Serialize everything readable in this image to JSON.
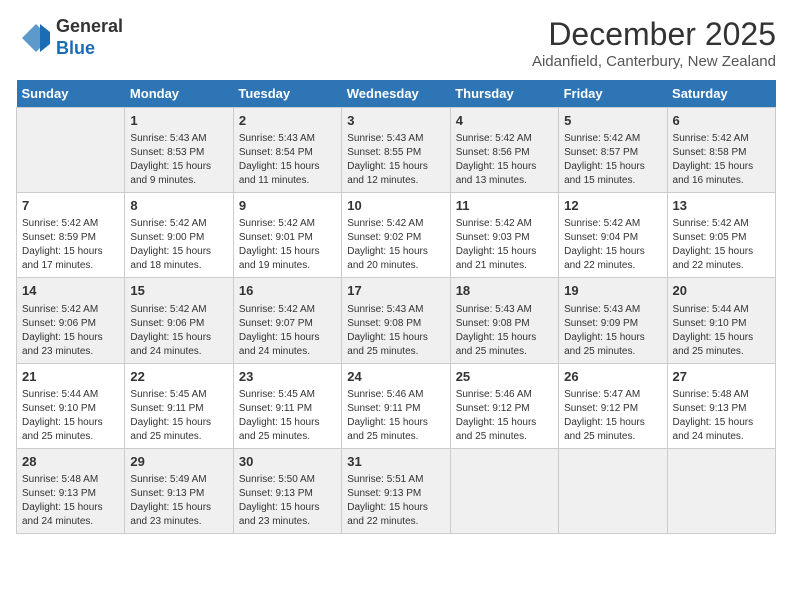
{
  "header": {
    "logo_line1": "General",
    "logo_line2": "Blue",
    "title": "December 2025",
    "location": "Aidanfield, Canterbury, New Zealand"
  },
  "calendar": {
    "days_of_week": [
      "Sunday",
      "Monday",
      "Tuesday",
      "Wednesday",
      "Thursday",
      "Friday",
      "Saturday"
    ],
    "weeks": [
      [
        {
          "day": "",
          "info": ""
        },
        {
          "day": "1",
          "info": "Sunrise: 5:43 AM\nSunset: 8:53 PM\nDaylight: 15 hours\nand 9 minutes."
        },
        {
          "day": "2",
          "info": "Sunrise: 5:43 AM\nSunset: 8:54 PM\nDaylight: 15 hours\nand 11 minutes."
        },
        {
          "day": "3",
          "info": "Sunrise: 5:43 AM\nSunset: 8:55 PM\nDaylight: 15 hours\nand 12 minutes."
        },
        {
          "day": "4",
          "info": "Sunrise: 5:42 AM\nSunset: 8:56 PM\nDaylight: 15 hours\nand 13 minutes."
        },
        {
          "day": "5",
          "info": "Sunrise: 5:42 AM\nSunset: 8:57 PM\nDaylight: 15 hours\nand 15 minutes."
        },
        {
          "day": "6",
          "info": "Sunrise: 5:42 AM\nSunset: 8:58 PM\nDaylight: 15 hours\nand 16 minutes."
        }
      ],
      [
        {
          "day": "7",
          "info": "Sunrise: 5:42 AM\nSunset: 8:59 PM\nDaylight: 15 hours\nand 17 minutes."
        },
        {
          "day": "8",
          "info": "Sunrise: 5:42 AM\nSunset: 9:00 PM\nDaylight: 15 hours\nand 18 minutes."
        },
        {
          "day": "9",
          "info": "Sunrise: 5:42 AM\nSunset: 9:01 PM\nDaylight: 15 hours\nand 19 minutes."
        },
        {
          "day": "10",
          "info": "Sunrise: 5:42 AM\nSunset: 9:02 PM\nDaylight: 15 hours\nand 20 minutes."
        },
        {
          "day": "11",
          "info": "Sunrise: 5:42 AM\nSunset: 9:03 PM\nDaylight: 15 hours\nand 21 minutes."
        },
        {
          "day": "12",
          "info": "Sunrise: 5:42 AM\nSunset: 9:04 PM\nDaylight: 15 hours\nand 22 minutes."
        },
        {
          "day": "13",
          "info": "Sunrise: 5:42 AM\nSunset: 9:05 PM\nDaylight: 15 hours\nand 22 minutes."
        }
      ],
      [
        {
          "day": "14",
          "info": "Sunrise: 5:42 AM\nSunset: 9:06 PM\nDaylight: 15 hours\nand 23 minutes."
        },
        {
          "day": "15",
          "info": "Sunrise: 5:42 AM\nSunset: 9:06 PM\nDaylight: 15 hours\nand 24 minutes."
        },
        {
          "day": "16",
          "info": "Sunrise: 5:42 AM\nSunset: 9:07 PM\nDaylight: 15 hours\nand 24 minutes."
        },
        {
          "day": "17",
          "info": "Sunrise: 5:43 AM\nSunset: 9:08 PM\nDaylight: 15 hours\nand 25 minutes."
        },
        {
          "day": "18",
          "info": "Sunrise: 5:43 AM\nSunset: 9:08 PM\nDaylight: 15 hours\nand 25 minutes."
        },
        {
          "day": "19",
          "info": "Sunrise: 5:43 AM\nSunset: 9:09 PM\nDaylight: 15 hours\nand 25 minutes."
        },
        {
          "day": "20",
          "info": "Sunrise: 5:44 AM\nSunset: 9:10 PM\nDaylight: 15 hours\nand 25 minutes."
        }
      ],
      [
        {
          "day": "21",
          "info": "Sunrise: 5:44 AM\nSunset: 9:10 PM\nDaylight: 15 hours\nand 25 minutes."
        },
        {
          "day": "22",
          "info": "Sunrise: 5:45 AM\nSunset: 9:11 PM\nDaylight: 15 hours\nand 25 minutes."
        },
        {
          "day": "23",
          "info": "Sunrise: 5:45 AM\nSunset: 9:11 PM\nDaylight: 15 hours\nand 25 minutes."
        },
        {
          "day": "24",
          "info": "Sunrise: 5:46 AM\nSunset: 9:11 PM\nDaylight: 15 hours\nand 25 minutes."
        },
        {
          "day": "25",
          "info": "Sunrise: 5:46 AM\nSunset: 9:12 PM\nDaylight: 15 hours\nand 25 minutes."
        },
        {
          "day": "26",
          "info": "Sunrise: 5:47 AM\nSunset: 9:12 PM\nDaylight: 15 hours\nand 25 minutes."
        },
        {
          "day": "27",
          "info": "Sunrise: 5:48 AM\nSunset: 9:13 PM\nDaylight: 15 hours\nand 24 minutes."
        }
      ],
      [
        {
          "day": "28",
          "info": "Sunrise: 5:48 AM\nSunset: 9:13 PM\nDaylight: 15 hours\nand 24 minutes."
        },
        {
          "day": "29",
          "info": "Sunrise: 5:49 AM\nSunset: 9:13 PM\nDaylight: 15 hours\nand 23 minutes."
        },
        {
          "day": "30",
          "info": "Sunrise: 5:50 AM\nSunset: 9:13 PM\nDaylight: 15 hours\nand 23 minutes."
        },
        {
          "day": "31",
          "info": "Sunrise: 5:51 AM\nSunset: 9:13 PM\nDaylight: 15 hours\nand 22 minutes."
        },
        {
          "day": "",
          "info": ""
        },
        {
          "day": "",
          "info": ""
        },
        {
          "day": "",
          "info": ""
        }
      ]
    ]
  }
}
